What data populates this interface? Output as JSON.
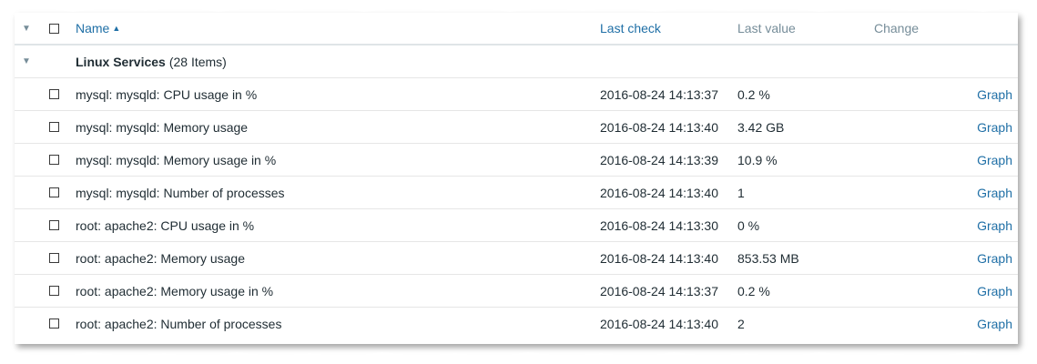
{
  "header": {
    "collapse_icon": "triangle-down-icon",
    "name_label": "Name",
    "sort_icon": "sort-ascending-icon",
    "last_check_label": "Last check",
    "last_value_label": "Last value",
    "change_label": "Change"
  },
  "group": {
    "collapse_icon": "triangle-down-icon",
    "name": "Linux Services",
    "count": "(28 Items)"
  },
  "items": [
    {
      "name": "mysql: mysqld: CPU usage in %",
      "last_check": "2016-08-24 14:13:37",
      "last_value": "0.2 %",
      "action": "Graph"
    },
    {
      "name": "mysql: mysqld: Memory usage",
      "last_check": "2016-08-24 14:13:40",
      "last_value": "3.42 GB",
      "action": "Graph"
    },
    {
      "name": "mysql: mysqld: Memory usage in %",
      "last_check": "2016-08-24 14:13:39",
      "last_value": "10.9 %",
      "action": "Graph"
    },
    {
      "name": "mysql: mysqld: Number of processes",
      "last_check": "2016-08-24 14:13:40",
      "last_value": "1",
      "action": "Graph"
    },
    {
      "name": "root: apache2: CPU usage in %",
      "last_check": "2016-08-24 14:13:30",
      "last_value": "0 %",
      "action": "Graph"
    },
    {
      "name": "root: apache2: Memory usage",
      "last_check": "2016-08-24 14:13:40",
      "last_value": "853.53 MB",
      "action": "Graph"
    },
    {
      "name": "root: apache2: Memory usage in %",
      "last_check": "2016-08-24 14:13:37",
      "last_value": "0.2 %",
      "action": "Graph"
    },
    {
      "name": "root: apache2: Number of processes",
      "last_check": "2016-08-24 14:13:40",
      "last_value": "2",
      "action": "Graph"
    }
  ],
  "colors": {
    "link": "#1f6fa6",
    "muted_header": "#768d99",
    "text": "#1f2c33",
    "row_border": "#e6e6e6"
  }
}
